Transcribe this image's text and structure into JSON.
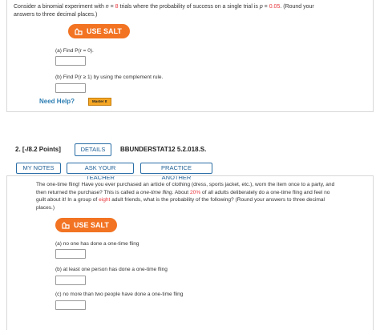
{
  "q1": {
    "intro_a": "Consider a binomial experiment with ",
    "n_sym": "n",
    "intro_b": " = ",
    "n_val": "8",
    "intro_c": " trials where the probability of success on a single trial is ",
    "p_sym": "p",
    "intro_d": " = ",
    "p_val": "0.05",
    "intro_e": ". (Round your",
    "intro_line2": "answers to three decimal places.)",
    "salt_label": "USE SALT",
    "part_a": "(a) Find P(r = 0).",
    "part_b": "(b) Find P(r ≥ 1) by using the complement rule.",
    "need_help": "Need Help?",
    "master_label": "Master It"
  },
  "q2": {
    "number": "2.",
    "points": "[-/8.2 Points]",
    "details_label": "DETAILS",
    "code": "BBUNDERSTAT12 5.2.018.S.",
    "my_notes_label": "MY NOTES",
    "ask_teacher_label": "ASK YOUR TEACHER",
    "practice_label": "PRACTICE ANOTHER",
    "text_l1": "The one-time fling! Have you ever purchased an article of clothing (dress, sports jacket, etc.), worn the item once to a party, and",
    "text_l2a": "then returned the purchase? This is called a ",
    "text_l2_italic": "one-time fling",
    "text_l2b": ". About ",
    "text_l2_pct": "20%",
    "text_l2c": " of all adults deliberately do a one-time fling and feel no",
    "text_l3a": "guilt about it! In a group of ",
    "text_l3_eight": "eight",
    "text_l3b": " adult friends, what is the probability of the following? (Round your answers to three decimal",
    "text_l4": "places.)",
    "salt_label": "USE SALT",
    "part_a": "(a) no one has done a one-time fling",
    "part_b": "(b) at least one person has done a one-time fling",
    "part_c": "(c) no more than two people have done a one-time fling"
  },
  "colors": {
    "salt_orange": "#f27322",
    "link_blue": "#2f7fb3",
    "highlight_red": "#e8343a"
  }
}
